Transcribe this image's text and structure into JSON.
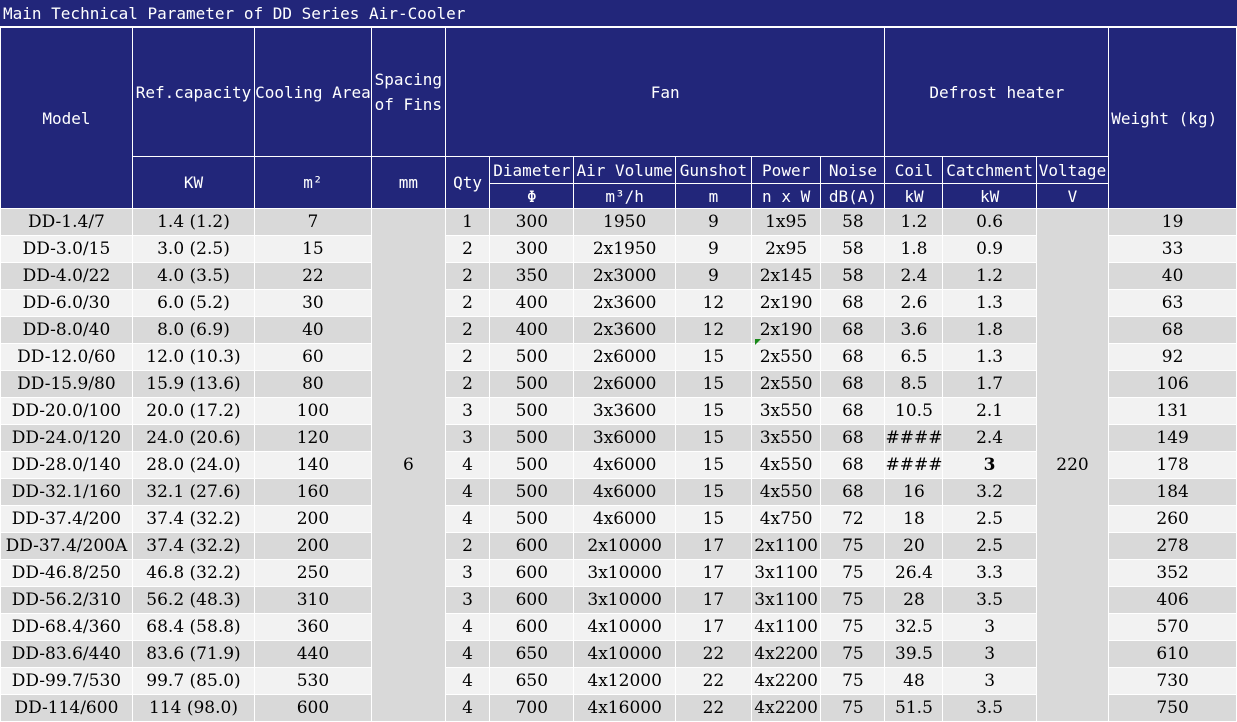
{
  "title": "Main Technical Parameter of DD Series Air-Cooler",
  "headers": {
    "model": "Model",
    "ref_capacity": "Ref.capacity",
    "cooling_area": "Cooling Area",
    "spacing": "Spacing of Fins",
    "fan": "Fan",
    "defrost": "Defrost heater",
    "weight": "Weight (kg)",
    "qty": "Qty",
    "diameter": "Diameter",
    "air_volume": "Air Volume",
    "gunshot": "Gunshot",
    "power": "Power",
    "noise": "Noise",
    "coil": "Coil",
    "catchment": "Catchment",
    "voltage": "Voltage"
  },
  "units": {
    "ref_capacity": "KW",
    "cooling_area": "m²",
    "spacing": "mm",
    "diameter": "Φ",
    "air_volume": "m³/h",
    "gunshot": "m",
    "power": "n x W",
    "noise": "dB(A)",
    "coil": "kW",
    "catchment": "kW",
    "voltage": "V"
  },
  "spacing_value": "6",
  "voltage_value": "220",
  "rows": [
    {
      "model": "DD-1.4/7",
      "cap": "1.4 (1.2)",
      "area": "7",
      "qty": "1",
      "dia": "300",
      "air": "1950",
      "gun": "9",
      "power": "1x95",
      "noise": "58",
      "coil": "1.2",
      "catch": "0.6",
      "weight": "19"
    },
    {
      "model": "DD-3.0/15",
      "cap": "3.0 (2.5)",
      "area": "15",
      "qty": "2",
      "dia": "300",
      "air": "2x1950",
      "gun": "9",
      "power": "2x95",
      "noise": "58",
      "coil": "1.8",
      "catch": "0.9",
      "weight": "33"
    },
    {
      "model": "DD-4.0/22",
      "cap": "4.0 (3.5)",
      "area": "22",
      "qty": "2",
      "dia": "350",
      "air": "2x3000",
      "gun": "9",
      "power": "2x145",
      "noise": "58",
      "coil": "2.4",
      "catch": "1.2",
      "weight": "40"
    },
    {
      "model": "DD-6.0/30",
      "cap": "6.0 (5.2)",
      "area": "30",
      "qty": "2",
      "dia": "400",
      "air": "2x3600",
      "gun": "12",
      "power": "2x190",
      "noise": "68",
      "coil": "2.6",
      "catch": "1.3",
      "weight": "63"
    },
    {
      "model": "DD-8.0/40",
      "cap": "8.0 (6.9)",
      "area": "40",
      "qty": "2",
      "dia": "400",
      "air": "2x3600",
      "gun": "12",
      "power": "2x190",
      "noise": "68",
      "coil": "3.6",
      "catch": "1.8",
      "weight": "68"
    },
    {
      "model": "DD-12.0/60",
      "cap": "12.0 (10.3)",
      "area": "60",
      "qty": "2",
      "dia": "500",
      "air": "2x6000",
      "gun": "15",
      "power": "2x550",
      "noise": "68",
      "coil": "6.5",
      "catch": "1.3",
      "weight": "92"
    },
    {
      "model": "DD-15.9/80",
      "cap": "15.9 (13.6)",
      "area": "80",
      "qty": "2",
      "dia": "500",
      "air": "2x6000",
      "gun": "15",
      "power": "2x550",
      "noise": "68",
      "coil": "8.5",
      "catch": "1.7",
      "weight": "106"
    },
    {
      "model": "DD-20.0/100",
      "cap": "20.0 (17.2)",
      "area": "100",
      "qty": "3",
      "dia": "500",
      "air": "3x3600",
      "gun": "15",
      "power": "3x550",
      "noise": "68",
      "coil": "10.5",
      "catch": "2.1",
      "weight": "131"
    },
    {
      "model": "DD-24.0/120",
      "cap": "24.0 (20.6)",
      "area": "120",
      "qty": "3",
      "dia": "500",
      "air": "3x6000",
      "gun": "15",
      "power": "3x550",
      "noise": "68",
      "coil": "####",
      "catch": "2.4",
      "weight": "149"
    },
    {
      "model": "DD-28.0/140",
      "cap": "28.0 (24.0)",
      "area": "140",
      "qty": "4",
      "dia": "500",
      "air": "4x6000",
      "gun": "15",
      "power": "4x550",
      "noise": "68",
      "coil": "####",
      "catch": "3",
      "weight": "178"
    },
    {
      "model": "DD-32.1/160",
      "cap": "32.1 (27.6)",
      "area": "160",
      "qty": "4",
      "dia": "500",
      "air": "4x6000",
      "gun": "15",
      "power": "4x550",
      "noise": "68",
      "coil": "16",
      "catch": "3.2",
      "weight": "184"
    },
    {
      "model": "DD-37.4/200",
      "cap": "37.4 (32.2)",
      "area": "200",
      "qty": "4",
      "dia": "500",
      "air": "4x6000",
      "gun": "15",
      "power": "4x750",
      "noise": "72",
      "coil": "18",
      "catch": "2.5",
      "weight": "260"
    },
    {
      "model": "DD-37.4/200A",
      "cap": "37.4 (32.2)",
      "area": "200",
      "qty": "2",
      "dia": "600",
      "air": "2x10000",
      "gun": "17",
      "power": "2x1100",
      "noise": "75",
      "coil": "20",
      "catch": "2.5",
      "weight": "278"
    },
    {
      "model": "DD-46.8/250",
      "cap": "46.8 (32.2)",
      "area": "250",
      "qty": "3",
      "dia": "600",
      "air": "3x10000",
      "gun": "17",
      "power": "3x1100",
      "noise": "75",
      "coil": "26.4",
      "catch": "3.3",
      "weight": "352"
    },
    {
      "model": "DD-56.2/310",
      "cap": "56.2 (48.3)",
      "area": "310",
      "qty": "3",
      "dia": "600",
      "air": "3x10000",
      "gun": "17",
      "power": "3x1100",
      "noise": "75",
      "coil": "28",
      "catch": "3.5",
      "weight": "406"
    },
    {
      "model": "DD-68.4/360",
      "cap": "68.4 (58.8)",
      "area": "360",
      "qty": "4",
      "dia": "600",
      "air": "4x10000",
      "gun": "17",
      "power": "4x1100",
      "noise": "75",
      "coil": "32.5",
      "catch": "3",
      "weight": "570"
    },
    {
      "model": "DD-83.6/440",
      "cap": "83.6 (71.9)",
      "area": "440",
      "qty": "4",
      "dia": "650",
      "air": "4x10000",
      "gun": "22",
      "power": "4x2200",
      "noise": "75",
      "coil": "39.5",
      "catch": "3",
      "weight": "610"
    },
    {
      "model": "DD-99.7/530",
      "cap": "99.7 (85.0)",
      "area": "530",
      "qty": "4",
      "dia": "650",
      "air": "4x12000",
      "gun": "22",
      "power": "4x2200",
      "noise": "75",
      "coil": "48",
      "catch": "3",
      "weight": "730"
    },
    {
      "model": "DD-114/600",
      "cap": "114 (98.0)",
      "area": "600",
      "qty": "4",
      "dia": "700",
      "air": "4x16000",
      "gun": "22",
      "power": "4x2200",
      "noise": "75",
      "coil": "51.5",
      "catch": "3.5",
      "weight": "750"
    }
  ]
}
